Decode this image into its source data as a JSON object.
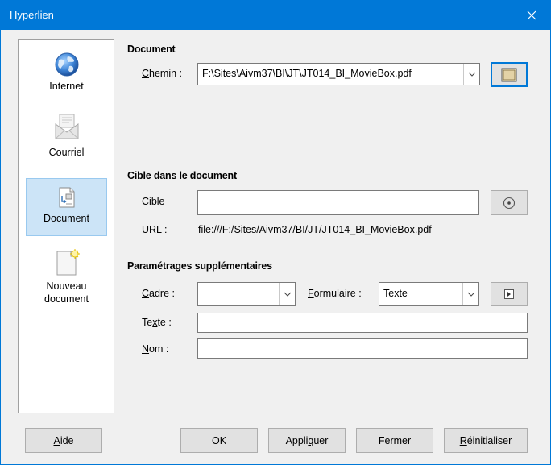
{
  "window": {
    "title": "Hyperlien"
  },
  "categories": [
    {
      "label": "Internet",
      "icon": "globe-icon"
    },
    {
      "label": "Courriel",
      "icon": "envelope-icon"
    },
    {
      "label": "Document",
      "icon": "document-link-icon",
      "selected": true
    },
    {
      "label": "Nouveau document",
      "icon": "new-document-icon"
    }
  ],
  "document_section": {
    "title": "Document",
    "path_label_first": "C",
    "path_label_rest": "hemin :",
    "path_value": "F:\\Sites\\Aivm37\\BI\\JT\\JT014_BI_MovieBox.pdf"
  },
  "target_section": {
    "title": "Cible dans le document",
    "target_label_pre": "Ci",
    "target_label_u": "b",
    "target_label_post": "le",
    "target_value": "",
    "url_label": "URL :",
    "url_value": "file:///F:/Sites/Aivm37/BI/JT/JT014_BI_MovieBox.pdf"
  },
  "extra_section": {
    "title": "Paramétrages supplémentaires",
    "frame_label_first": "C",
    "frame_label_rest": "adre :",
    "frame_value": "",
    "form_label_first": "F",
    "form_label_rest": "ormulaire :",
    "form_value": "Texte",
    "text_label_pre": "Te",
    "text_label_u": "x",
    "text_label_post": "te :",
    "text_value": "",
    "name_label_first": "N",
    "name_label_rest": "om :",
    "name_value": ""
  },
  "buttons": {
    "help_first": "A",
    "help_rest": "ide",
    "ok": "OK",
    "apply_pre": "Appli",
    "apply_u": "q",
    "apply_post": "uer",
    "close": "Fermer",
    "reset_first": "R",
    "reset_rest": "éinitialiser"
  },
  "colors": {
    "accent": "#0078d7",
    "selection": "#cce4f7"
  }
}
